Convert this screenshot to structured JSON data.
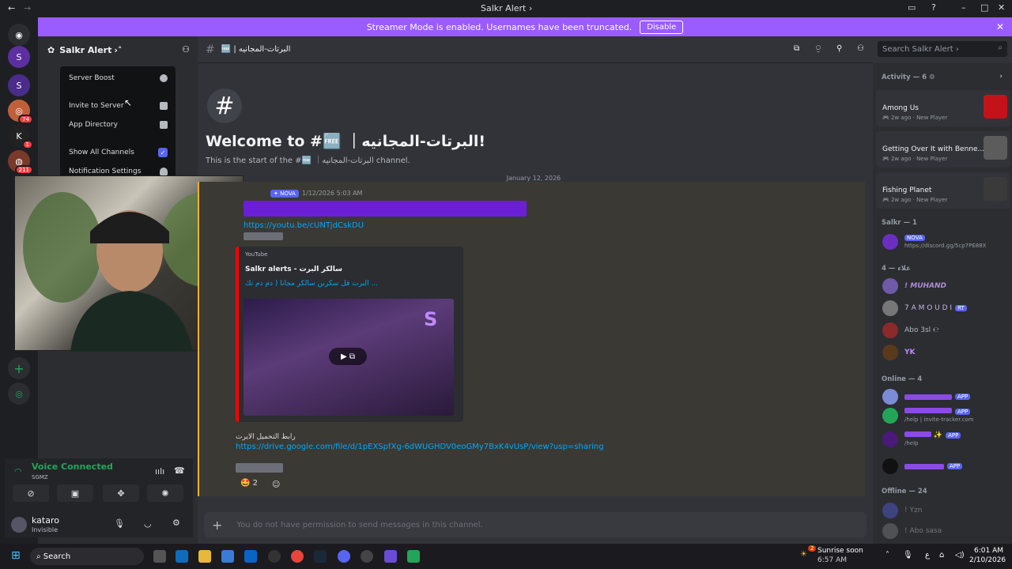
{
  "window": {
    "title": "Salkr Alert"
  },
  "banner": {
    "text": "Streamer Mode is enabled. Usernames have been truncated.",
    "disable_label": "Disable"
  },
  "rail": {
    "badges": [
      "74",
      "1",
      "211"
    ]
  },
  "server": {
    "name": "Salkr Alert"
  },
  "dropdown": {
    "items": [
      {
        "label": "Server Boost"
      },
      {
        "label": "Invite to Server"
      },
      {
        "label": "App Directory"
      },
      {
        "label": "Show All Channels"
      },
      {
        "label": "Notification Settings"
      }
    ]
  },
  "voice": {
    "status": "Voice Connected",
    "channel": "SGMZ",
    "user": "kataro",
    "user_status": "Invisible"
  },
  "channel": {
    "header_name": "البرتات-المجانيه",
    "welcome_title": "Welcome to #🆓 ｜البرتات-المجانيه!",
    "welcome_sub": "This is the start of the #🆓 ｜البرتات-المجانيه channel.",
    "date": "January 12, 2026",
    "search_placeholder": "Search Salkr Alert"
  },
  "message": {
    "tag": "NOVA",
    "timestamp": "1/12/2026 5:03 AM",
    "link1": "https://youtu.be/cUNTjdCskDU",
    "embed_provider": "YouTube",
    "embed_author": "Salkr alerts - سالكر البرت",
    "embed_title": "البرت قل سكربن سالكر مجانا ( دم دم تك ...",
    "download_label": "رابط التحميل الايرت",
    "link2": "https://drive.google.com/file/d/1pEXSpfXg-6dWUGHDV0eoGMy7BxK4vUsP/view?usp=sharing",
    "reaction_count": "2"
  },
  "composer": {
    "placeholder": "You do not have permission to send messages in this channel."
  },
  "members": {
    "activity_header": "Activity — 6",
    "activities": [
      {
        "game": "Among Us",
        "meta": "2w ago",
        "tag": "New Player"
      },
      {
        "game": "Getting Over It with Benne...",
        "meta": "2w ago",
        "tag": "New Player"
      },
      {
        "game": "Fishing Planet",
        "meta": "2w ago",
        "tag": "New Player"
      }
    ],
    "salkr_header": "Salkr — 1",
    "salkr_member": {
      "tag": "NOVA",
      "status": "https://discord.gg/5cp7PE88X"
    },
    "ola_header": "علاء — 4",
    "ola_members": [
      "! MUHAND",
      "7 A M O U D I",
      "Abo 3sl ℮",
      "YK"
    ],
    "ola_rt": "RT",
    "online_header": "Online — 4",
    "online_members": [
      {
        "status": "",
        "app": "APP"
      },
      {
        "status": "/help | invite-tracker.com",
        "app": "APP"
      },
      {
        "status": "/help",
        "app": "APP"
      },
      {
        "status": "",
        "app": "APP"
      }
    ],
    "offline_header": "Offline — 24",
    "offline_members": [
      "! Yzn",
      "! Abo sasa"
    ]
  },
  "taskbar": {
    "search": "Search",
    "weather_title": "Sunrise soon",
    "weather_time": "6:57 AM",
    "weather_badge": "2",
    "lang": "ع",
    "time": "6:01 AM",
    "date": "2/10/2026"
  }
}
